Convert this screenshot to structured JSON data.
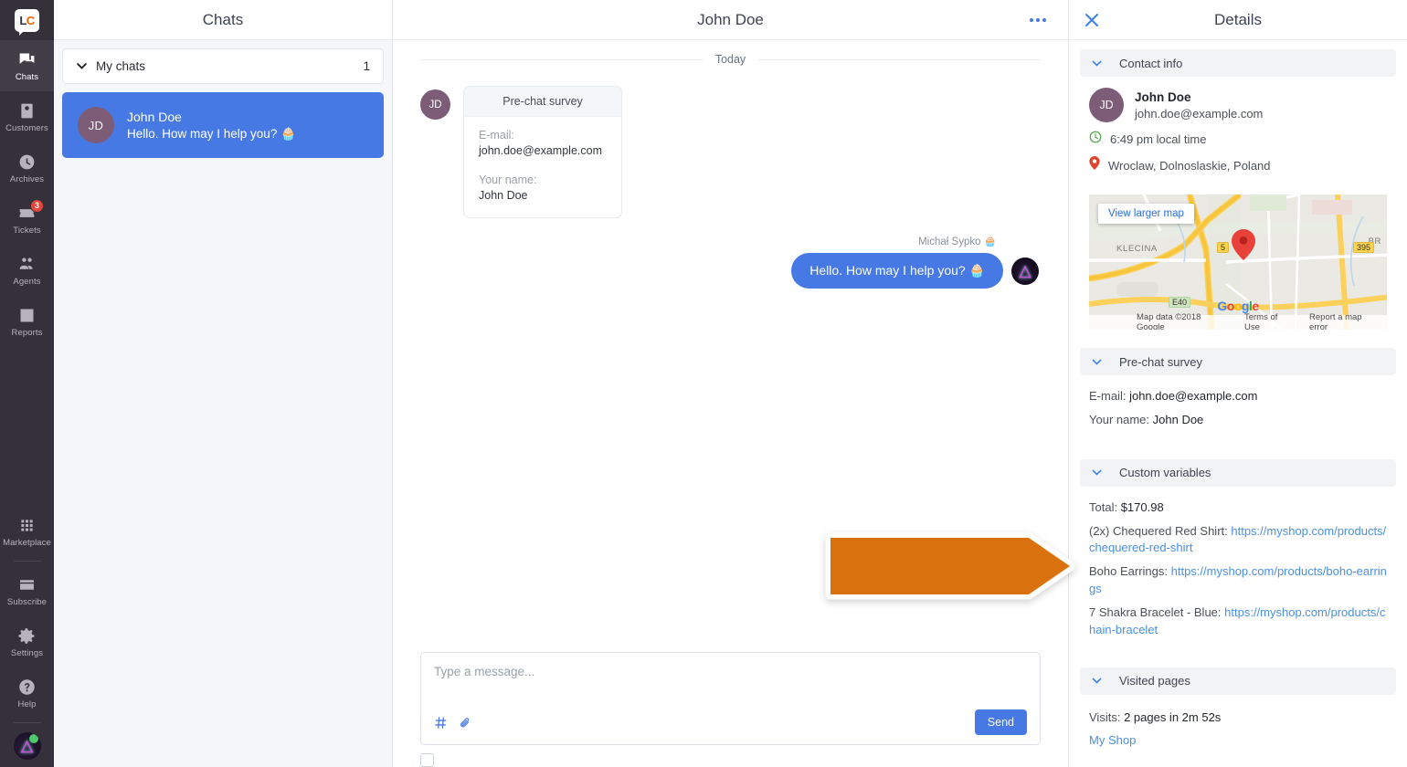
{
  "rail": {
    "logo": "LC",
    "items": [
      {
        "label": "Chats",
        "icon": "chats-icon",
        "active": true
      },
      {
        "label": "Customers",
        "icon": "customers-icon",
        "active": false
      },
      {
        "label": "Archives",
        "icon": "archives-clock-icon",
        "active": false
      },
      {
        "label": "Tickets",
        "icon": "tickets-icon",
        "active": false,
        "badge": "3"
      },
      {
        "label": "Agents",
        "icon": "agents-icon",
        "active": false
      },
      {
        "label": "Reports",
        "icon": "reports-bar-icon",
        "active": false
      }
    ],
    "bottom_items": [
      {
        "label": "Marketplace",
        "icon": "marketplace-grid-icon"
      },
      {
        "label": "Subscribe",
        "icon": "subscribe-card-icon"
      },
      {
        "label": "Settings",
        "icon": "settings-gear-icon"
      },
      {
        "label": "Help",
        "icon": "help-question-icon"
      }
    ]
  },
  "chatlist": {
    "title": "Chats",
    "group": {
      "label": "My chats",
      "count": "1"
    },
    "items": [
      {
        "initials": "JD",
        "name": "John Doe",
        "preview": "Hello. How may I help you? 🧁"
      }
    ]
  },
  "conversation": {
    "title": "John Doe",
    "day_separator": "Today",
    "survey": {
      "header": "Pre-chat survey",
      "fields": [
        {
          "label": "E-mail:",
          "value": "john.doe@example.com"
        },
        {
          "label": "Your name:",
          "value": "John Doe"
        }
      ],
      "avatar_initials": "JD"
    },
    "agent_message": {
      "author": "Michał Sypko 🧁",
      "text": "Hello. How may I help you? 🧁"
    },
    "composer": {
      "placeholder": "Type a message...",
      "send_label": "Send",
      "canned_icon": "hash-icon",
      "attach_icon": "paperclip-icon"
    }
  },
  "details": {
    "title": "Details",
    "close_icon": "close-icon",
    "sections": {
      "contact_info": {
        "heading": "Contact info",
        "name": "John Doe",
        "email": "john.doe@example.com",
        "initials": "JD",
        "local_time": "6:49 pm local time",
        "location": "Wroclaw, Dolnoslaskie, Poland",
        "map": {
          "view_larger": "View larger map",
          "attribution": "Map data ©2018 Google",
          "terms": "Terms of Use",
          "report": "Report a map error",
          "watermark": "Google",
          "labels": [
            "KLECINA",
            "BR"
          ],
          "road_badges": [
            "5",
            "395",
            "E40"
          ]
        }
      },
      "pre_chat_survey": {
        "heading": "Pre-chat survey",
        "rows": [
          {
            "label": "E-mail:",
            "value": "john.doe@example.com"
          },
          {
            "label": "Your name:",
            "value": "John Doe"
          }
        ]
      },
      "custom_variables": {
        "heading": "Custom variables",
        "total_label": "Total:",
        "total_value": "$170.98",
        "products": [
          {
            "name": "(2x) Chequered Red Shirt:",
            "url": "https://myshop.com/products/chequered-red-shirt"
          },
          {
            "name": "Boho Earrings:",
            "url": "https://myshop.com/products/boho-earrings"
          },
          {
            "name": "7 Shakra Bracelet - Blue:",
            "url": "https://myshop.com/products/chain-bracelet"
          }
        ]
      },
      "visited_pages": {
        "heading": "Visited pages",
        "visits_label": "Visits:",
        "visits_value": "2 pages in 2m 52s",
        "page_link": "My Shop"
      }
    }
  },
  "annotation": {
    "type": "arrow-pointing-right",
    "color": "#d9720e",
    "border_color": "#ffffff"
  }
}
